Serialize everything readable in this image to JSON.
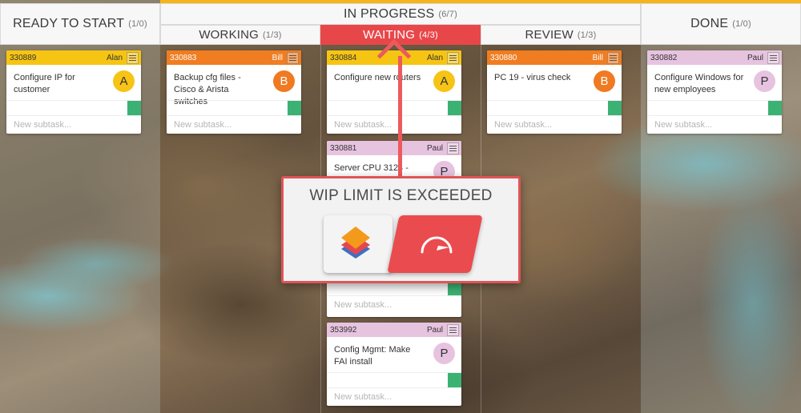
{
  "columns": {
    "ready": {
      "title": "READY TO START",
      "count": "(1/0)"
    },
    "in_progress": {
      "title": "IN PROGRESS",
      "count": "(6/7)"
    },
    "working": {
      "title": "WORKING",
      "count": "(1/3)"
    },
    "waiting": {
      "title": "WAITING",
      "count": "(4/3)"
    },
    "review": {
      "title": "REVIEW",
      "count": "(1/3)"
    },
    "done": {
      "title": "DONE",
      "count": "(1/0)"
    }
  },
  "cards": [
    {
      "id": "330889",
      "owner": "Alan",
      "title": "Configure IP for customer",
      "initial": "A",
      "color": "yellow",
      "subtask": "New subtask..."
    },
    {
      "id": "330883",
      "owner": "Bill",
      "title": "Backup cfg files - Cisco & Arista switches",
      "initial": "B",
      "color": "orange",
      "subtask": "New subtask..."
    },
    {
      "id": "330884",
      "owner": "Alan",
      "title": "Configure new routers",
      "initial": "A",
      "color": "yellow",
      "subtask": "New subtask..."
    },
    {
      "id": "330881",
      "owner": "Paul",
      "title": "Server CPU 3124 - high",
      "initial": "P",
      "color": "pink",
      "subtask": "New subtask..."
    },
    {
      "id": "353992",
      "owner": "Paul",
      "title": "Config Mgmt: Make FAI install",
      "initial": "P",
      "color": "pink",
      "subtask": "New subtask..."
    },
    {
      "id": "330880",
      "owner": "Bill",
      "title": "PC 19 - virus check",
      "initial": "B",
      "color": "orange",
      "subtask": "New subtask..."
    },
    {
      "id": "330882",
      "owner": "Paul",
      "title": "Configure Windows for new employees",
      "initial": "P",
      "color": "pink",
      "subtask": "New subtask..."
    }
  ],
  "wip_alert": {
    "title": "WIP LIMIT IS EXCEEDED"
  },
  "colors": {
    "accent_red": "#e8474a",
    "yellow": "#f6c513",
    "orange": "#f07d21",
    "pink": "#e6c3df",
    "green": "#3bb273"
  }
}
